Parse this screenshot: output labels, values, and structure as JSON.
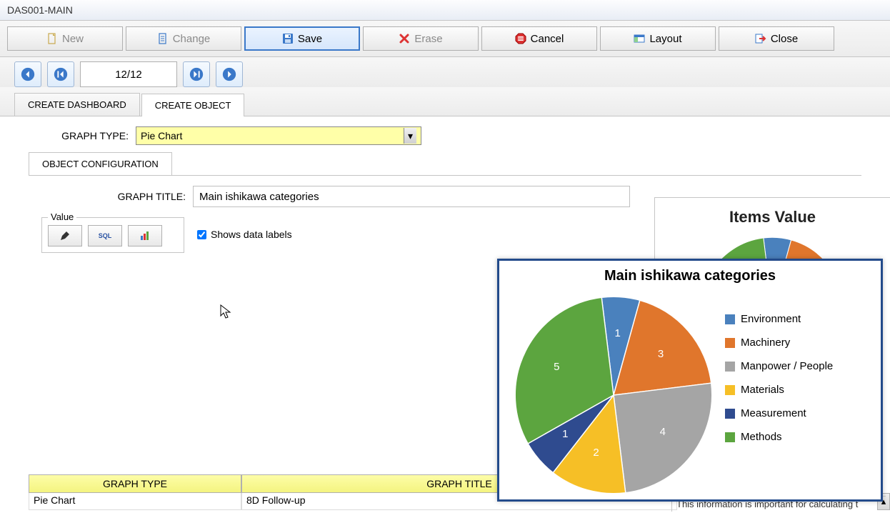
{
  "window": {
    "title": "DAS001-MAIN"
  },
  "toolbar": {
    "new": "New",
    "change": "Change",
    "save": "Save",
    "erase": "Erase",
    "cancel": "Cancel",
    "layout": "Layout",
    "close": "Close"
  },
  "nav": {
    "page": "12/12"
  },
  "tabs": {
    "dashboard": "CREATE DASHBOARD",
    "object": "CREATE OBJECT"
  },
  "form": {
    "graph_type_label": "GRAPH TYPE:",
    "graph_type_value": "Pie Chart",
    "inner_tab": "OBJECT CONFIGURATION",
    "graph_title_label": "GRAPH TITLE:",
    "graph_title_value": "Main ishikawa categories",
    "value_legend": "Value",
    "sql_label": "SQL",
    "shows_labels": "Shows data labels"
  },
  "preview": {
    "header": "Items Value"
  },
  "grid": {
    "col_a": "GRAPH TYPE",
    "col_b": "GRAPH TITLE",
    "row1_a": "Pie Chart",
    "row1_b": "8D Follow-up"
  },
  "footer": "This information is important for calculating t",
  "chart_data": {
    "type": "pie",
    "title": "Main ishikawa categories",
    "series": [
      {
        "name": "Environment",
        "value": 1,
        "color": "#4a81bd"
      },
      {
        "name": "Machinery",
        "value": 3,
        "color": "#e0762c"
      },
      {
        "name": "Manpower / People",
        "value": 4,
        "color": "#a5a5a5"
      },
      {
        "name": "Materials",
        "value": 2,
        "color": "#f6bf26"
      },
      {
        "name": "Measurement",
        "value": 1,
        "color": "#2f4b8f"
      },
      {
        "name": "Methods",
        "value": 5,
        "color": "#5ca53f"
      }
    ]
  }
}
